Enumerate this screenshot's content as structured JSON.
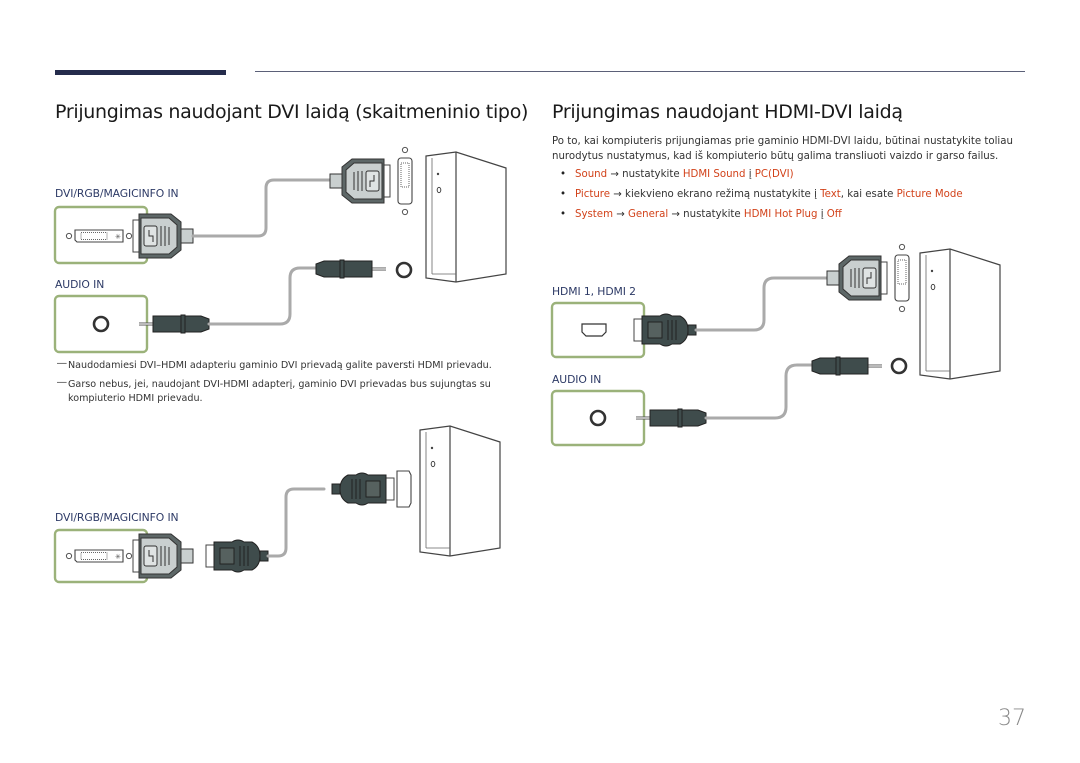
{
  "header": {
    "left_title": "Prijungimas naudojant DVI laidą (skaitmeninio tipo)",
    "right_title": "Prijungimas naudojant HDMI-DVI laidą"
  },
  "right": {
    "intro": "Po to, kai kompiuteris prijungiamas prie gaminio HDMI-DVI laidu, būtinai nustatykite toliau nurodytus nustatymus, kad iš kompiuterio būtų galima transliuoti vaizdo ir garso failus.",
    "bullets": [
      {
        "parts": [
          {
            "t": "Sound",
            "hl": true
          },
          {
            "t": " → nustatykite ",
            "hl": false
          },
          {
            "t": "HDMI Sound",
            "hl": true
          },
          {
            "t": " į ",
            "hl": false
          },
          {
            "t": "PC(DVI)",
            "hl": true
          }
        ]
      },
      {
        "parts": [
          {
            "t": "Picture",
            "hl": true
          },
          {
            "t": " → kiekvieno ekrano režimą nustatykite į ",
            "hl": false
          },
          {
            "t": "Text",
            "hl": true
          },
          {
            "t": ", kai esate ",
            "hl": false
          },
          {
            "t": "Picture Mode",
            "hl": true
          }
        ]
      },
      {
        "parts": [
          {
            "t": "System",
            "hl": true
          },
          {
            "t": " → ",
            "hl": false
          },
          {
            "t": "General",
            "hl": true
          },
          {
            "t": " → nustatykite ",
            "hl": false
          },
          {
            "t": "HDMI Hot Plug",
            "hl": true
          },
          {
            "t": " į ",
            "hl": false
          },
          {
            "t": "Off",
            "hl": true
          }
        ]
      }
    ],
    "diagram": {
      "hdmi_label": "HDMI 1, HDMI 2",
      "audio_label": "AUDIO IN"
    }
  },
  "left": {
    "diagram1": {
      "dvi_label": "DVI/RGB/MAGICINFO IN",
      "audio_label": "AUDIO IN"
    },
    "notes": [
      "Naudodamiesi DVI–HDMI adapteriu gaminio DVI prievadą galite paversti HDMI prievadu.",
      "Garso nebus, jei, naudojant DVI-HDMI adapterį, gaminio DVI prievadas bus sujungtas su kompiuterio HDMI prievadu."
    ],
    "note_marker": "―",
    "diagram2": {
      "dvi_label": "DVI/RGB/MAGICINFO IN"
    }
  },
  "colors": {
    "accent": "#d2421a",
    "port_frame": "#9bb27a",
    "connector_dark": "#3f4c4c",
    "connector_light": "#c9cfcf",
    "label": "#2d3a66"
  },
  "footer": {
    "page_number": "37"
  }
}
